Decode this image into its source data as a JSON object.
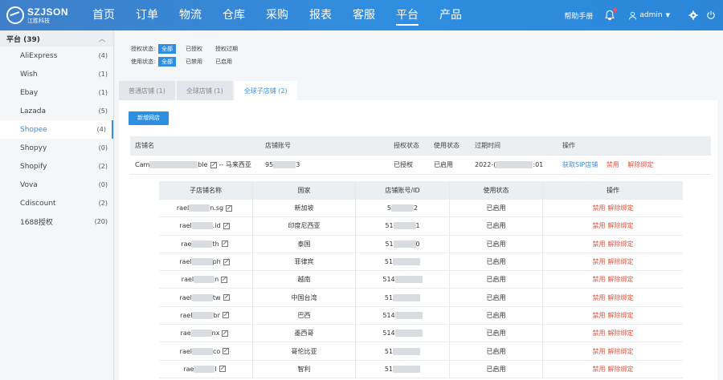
{
  "brand": {
    "name": "SZJSON",
    "sub": "江胜科技"
  },
  "nav": [
    {
      "label": "首页"
    },
    {
      "label": "订单"
    },
    {
      "label": "物流"
    },
    {
      "label": "仓库"
    },
    {
      "label": "采购"
    },
    {
      "label": "报表"
    },
    {
      "label": "客服"
    },
    {
      "label": "平台"
    },
    {
      "label": "产品"
    }
  ],
  "top": {
    "help": "帮助手册",
    "user": "admin"
  },
  "sidebar": {
    "title": "平台 (39)",
    "items": [
      {
        "label": "AliExpress",
        "count": "(4)"
      },
      {
        "label": "Wish",
        "count": "(1)"
      },
      {
        "label": "Ebay",
        "count": "(1)"
      },
      {
        "label": "Lazada",
        "count": "(5)"
      },
      {
        "label": "Shopee",
        "count": "(4)"
      },
      {
        "label": "Shopyy",
        "count": "(0)"
      },
      {
        "label": "Shopify",
        "count": "(2)"
      },
      {
        "label": "Vova",
        "count": "(0)"
      },
      {
        "label": "Cdiscount",
        "count": "(2)"
      },
      {
        "label": "1688授权",
        "count": "(20)"
      }
    ]
  },
  "filters": {
    "auth": {
      "label": "授权状态:",
      "options": [
        "全部",
        "已授权",
        "授权过期"
      ]
    },
    "use": {
      "label": "使用状态:",
      "options": [
        "全部",
        "已禁用",
        "已启用"
      ]
    }
  },
  "tabs": [
    {
      "label": "普通店铺 (1)"
    },
    {
      "label": "全球店铺 (1)"
    },
    {
      "label": "全球子店铺 (2)"
    }
  ],
  "add_button": "新增网店",
  "outer": {
    "headers": [
      "店铺名",
      "店铺账号",
      "授权状态",
      "使用状态",
      "过期时间",
      "操作"
    ],
    "row": {
      "name_pre": "Cam",
      "name_post": "ble",
      "name_suffix": "-- 马来西亚",
      "account_pre": "95",
      "account_post": "3",
      "auth": "已授权",
      "use": "已启用",
      "expire_pre": "2022-(",
      "expire_post": ":01",
      "op_sip": "获取SIP店铺",
      "op_disable": "禁用",
      "op_unbind": "解除绑定"
    }
  },
  "inner": {
    "headers": [
      "子店铺名称",
      "国家",
      "店铺账号/ID",
      "使用状态",
      "操作"
    ],
    "op_disable": "禁用",
    "op_unbind": "解除绑定",
    "rows": [
      {
        "pre": "rael",
        "post": "n.sg",
        "country": "新加坡",
        "id_pre": "5",
        "id_post": "2",
        "status": "已启用"
      },
      {
        "pre": "rael",
        "post": ".id",
        "country": "印度尼西亚",
        "id_pre": "51",
        "id_post": "1",
        "status": "已启用"
      },
      {
        "pre": "rae",
        "post": "th",
        "country": "泰国",
        "id_pre": "51",
        "id_post": "0",
        "status": "已启用"
      },
      {
        "pre": "rael",
        "post": "ph",
        "country": "菲律宾",
        "id_pre": "51",
        "id_post": "",
        "status": "已启用"
      },
      {
        "pre": "rael",
        "post": "n",
        "country": "越南",
        "id_pre": "514",
        "id_post": "",
        "status": "已启用"
      },
      {
        "pre": "rael",
        "post": "tw",
        "country": "中国台湾",
        "id_pre": "51",
        "id_post": "",
        "status": "已启用"
      },
      {
        "pre": "rael",
        "post": "br",
        "country": "巴西",
        "id_pre": "514",
        "id_post": "",
        "status": "已启用"
      },
      {
        "pre": "rae",
        "post": "nx",
        "country": "墨西哥",
        "id_pre": "514",
        "id_post": "",
        "status": "已启用"
      },
      {
        "pre": "rael",
        "post": "co",
        "country": "哥伦比亚",
        "id_pre": "51",
        "id_post": "",
        "status": "已启用"
      },
      {
        "pre": "rae",
        "post": "l",
        "country": "智利",
        "id_pre": "51",
        "id_post": "",
        "status": "已启用"
      }
    ]
  }
}
